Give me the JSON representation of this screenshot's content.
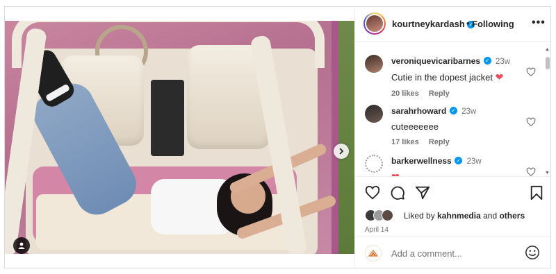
{
  "post": {
    "username": "kourtneykardash",
    "separator": "•",
    "follow_label": "Following",
    "more_label": "•••"
  },
  "comments": [
    {
      "user": "veroniquevicaribarnes",
      "time": "23w",
      "text": "Cutie in the dopest jacket",
      "likes": "20 likes",
      "reply": "Reply",
      "emoji": "heart"
    },
    {
      "user": "sarahrhoward",
      "time": "23w",
      "text": "cuteeeeeee",
      "likes": "17 likes",
      "reply": "Reply"
    },
    {
      "user": "barkerwellness",
      "time": "23w",
      "text": "",
      "emoji": "heart"
    }
  ],
  "likes": {
    "prefix": "Liked by",
    "user": "kahnmedia",
    "and": "and",
    "others": "others"
  },
  "date": "April 14",
  "add_comment": {
    "placeholder": "Add a comment..."
  },
  "colors": {
    "heart": "#ed4956",
    "verified": "#0095f6"
  }
}
